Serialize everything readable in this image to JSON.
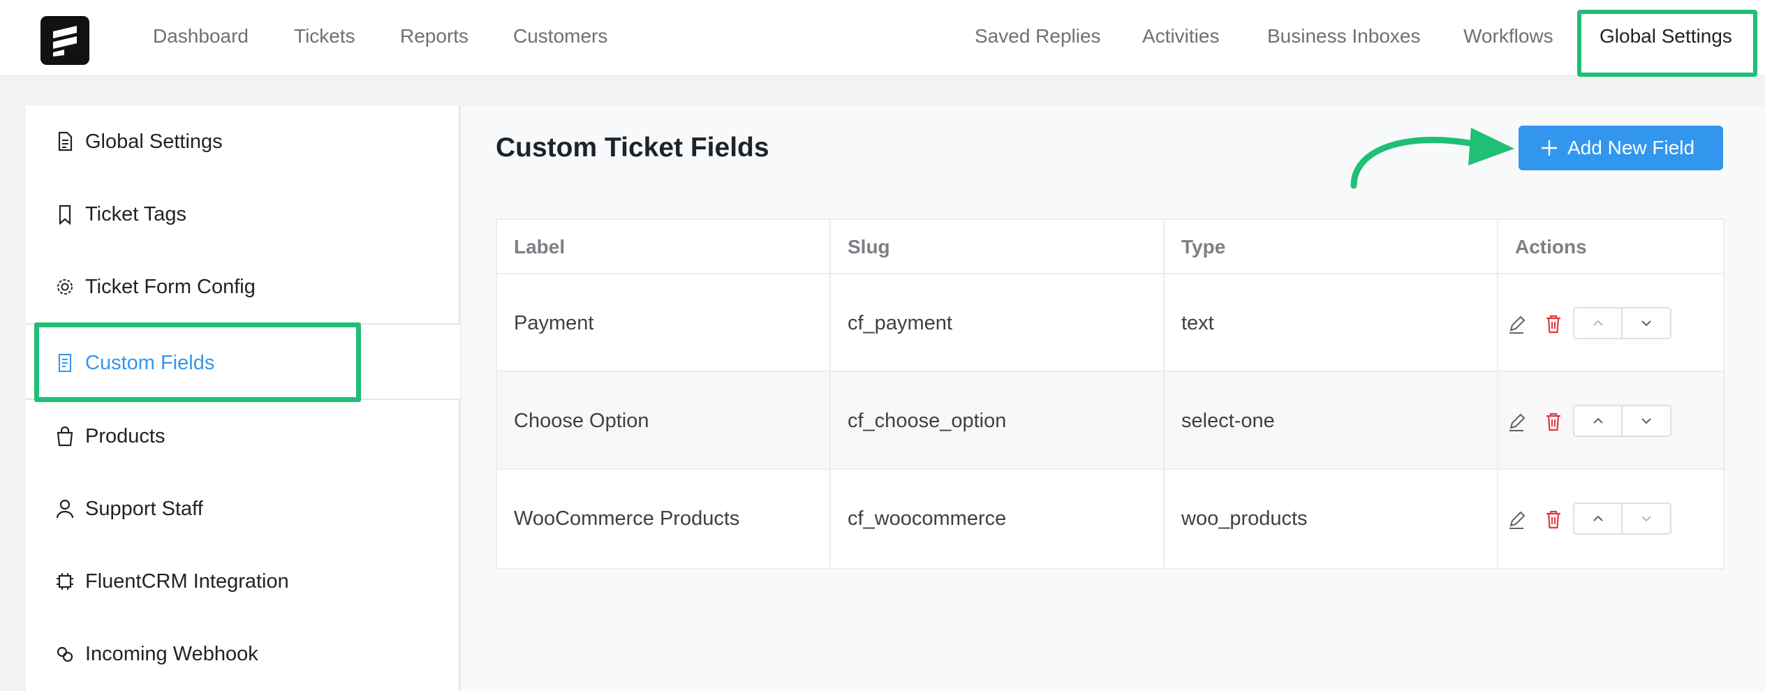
{
  "colors": {
    "accent": "#3296ee",
    "highlight": "#1fbf75",
    "delete": "#e0393e"
  },
  "nav": {
    "logo_icon": "fluent-logo-icon",
    "left": [
      "Dashboard",
      "Tickets",
      "Reports",
      "Customers"
    ],
    "right": [
      "Saved Replies",
      "Activities",
      "Business Inboxes",
      "Workflows",
      "Global Settings"
    ],
    "active": "Global Settings"
  },
  "sidebar": {
    "items": [
      {
        "label": "Global Settings",
        "icon": "document-icon"
      },
      {
        "label": "Ticket Tags",
        "icon": "bookmark-icon"
      },
      {
        "label": "Ticket Form Config",
        "icon": "gear-icon"
      },
      {
        "label": "Custom Fields",
        "icon": "form-icon",
        "active": true
      },
      {
        "label": "Products",
        "icon": "shopping-bag-icon"
      },
      {
        "label": "Support Staff",
        "icon": "user-icon"
      },
      {
        "label": "FluentCRM Integration",
        "icon": "chip-icon"
      },
      {
        "label": "Incoming Webhook",
        "icon": "webhook-icon"
      }
    ]
  },
  "main": {
    "title": "Custom Ticket Fields",
    "add_button": "Add New Field",
    "add_button_icon": "plus-icon",
    "table": {
      "headers": [
        "Label",
        "Slug",
        "Type",
        "Actions"
      ],
      "rows": [
        {
          "label": "Payment",
          "slug": "cf_payment",
          "type": "text"
        },
        {
          "label": "Choose Option",
          "slug": "cf_choose_option",
          "type": "select-one"
        },
        {
          "label": "WooCommerce Products",
          "slug": "cf_woocommerce",
          "type": "woo_products"
        }
      ],
      "action_icons": [
        "edit-icon",
        "trash-icon",
        "chevron-up-icon",
        "chevron-down-icon"
      ]
    }
  }
}
